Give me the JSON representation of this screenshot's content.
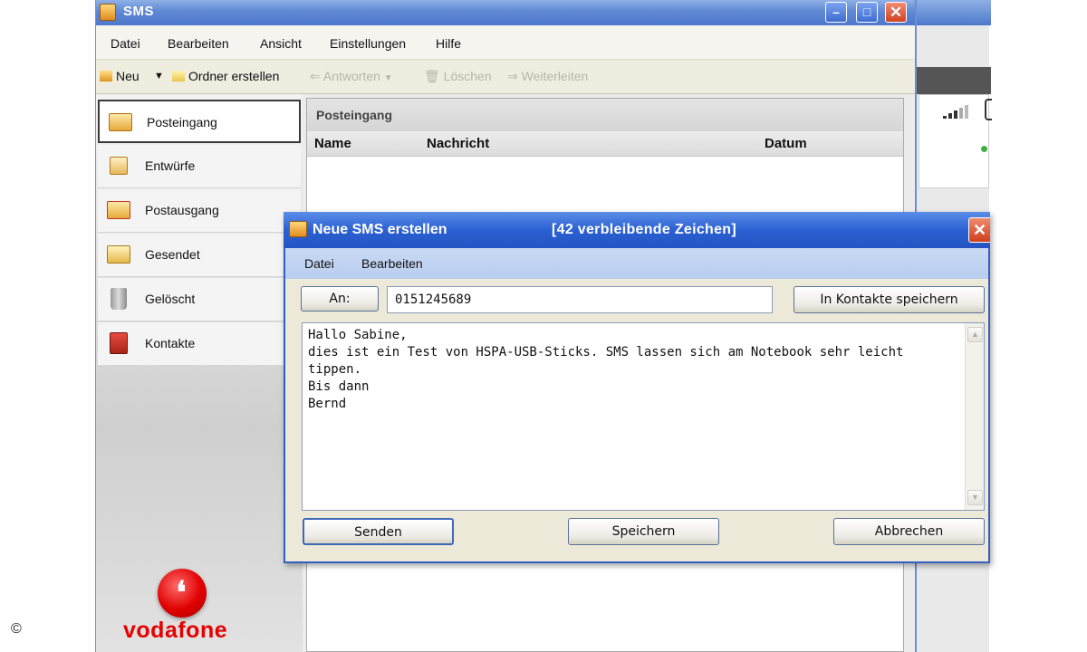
{
  "main_window": {
    "title": "SMS",
    "menu": [
      "Datei",
      "Bearbeiten",
      "Ansicht",
      "Einstellungen",
      "Hilfe"
    ],
    "toolbar": {
      "new": "Neu",
      "new_folder": "Ordner erstellen",
      "reply": "Antworten",
      "delete": "Löschen",
      "forward": "Weiterleiten"
    },
    "sidebar": [
      {
        "label": "Posteingang",
        "icon": "inbox-icon",
        "active": true
      },
      {
        "label": "Entwürfe",
        "icon": "drafts-icon"
      },
      {
        "label": "Postausgang",
        "icon": "outbox-icon"
      },
      {
        "label": "Gesendet",
        "icon": "sent-icon"
      },
      {
        "label": "Gelöscht",
        "icon": "trash-icon"
      },
      {
        "label": "Kontakte",
        "icon": "contacts-icon"
      }
    ],
    "inbox": {
      "title": "Posteingang",
      "columns": [
        "Name",
        "Nachricht",
        "Datum"
      ]
    },
    "brand": "vodafone"
  },
  "dialog": {
    "title": "Neue SMS erstellen",
    "remaining": "[42 verbleibende Zeichen]",
    "menu": [
      "Datei",
      "Bearbeiten"
    ],
    "to_label": "An:",
    "recipient": "0151245689",
    "save_contact_label": "In Kontakte speichern",
    "message": "Hallo Sabine,\ndies ist ein Test von HSPA-USB-Sticks. SMS lassen sich am Notebook sehr leicht\ntippen.\nBis dann\nBernd",
    "send_label": "Senden",
    "save_label": "Speichern",
    "cancel_label": "Abbrechen"
  },
  "copyright": "©",
  "colors": {
    "titlebar": "#4d79cc",
    "vodafone_red": "#e60000",
    "status_green": "#3cb043"
  }
}
